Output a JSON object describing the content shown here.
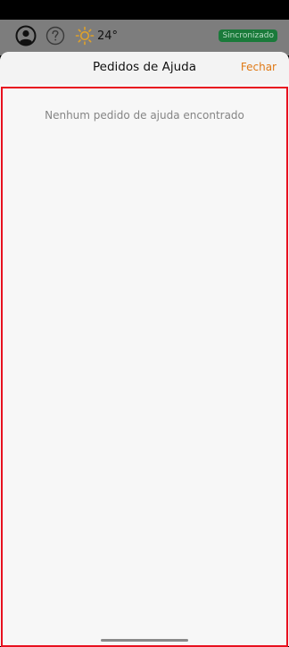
{
  "header": {
    "profile_icon": "user-circle-icon",
    "help_icon": "question-circle-icon",
    "weather_icon": "sun-icon",
    "temperature": "24°",
    "sync_status": "Sincronizado",
    "sync_color": "#1a7a3a",
    "weather_color": "#e0a22a"
  },
  "sheet": {
    "title": "Pedidos de Ajuda",
    "close_label": "Fechar",
    "close_color": "#e07a16",
    "empty_message": "Nenhum pedido de ajuda encontrado",
    "highlight_color": "#e8101f"
  }
}
